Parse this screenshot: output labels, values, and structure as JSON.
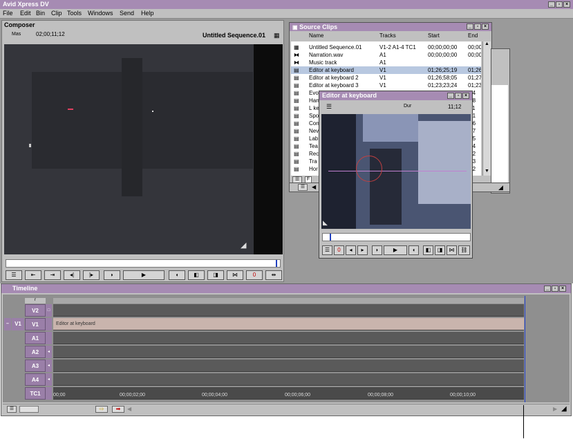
{
  "app": {
    "title": "Avid Xpress DV",
    "menu": [
      "File",
      "Edit",
      "Bin",
      "Clip",
      "Tools",
      "Windows",
      "Send",
      "Help"
    ]
  },
  "composer": {
    "title": "Composer",
    "mas_label": "Mas",
    "timecode": "02;00;11;12",
    "sequence_name": "Untitled Sequence.01"
  },
  "source_clips": {
    "title": "Source Clips",
    "columns": [
      "Name",
      "Tracks",
      "Start",
      "End"
    ],
    "rows": [
      {
        "name": "Untitled Sequence.01",
        "tracks": "V1-2 A1-4 TC1",
        "start": "00;00;00;00",
        "end": "00;00"
      },
      {
        "name": "Narration.wav",
        "tracks": "A1",
        "start": "00;00;00;00",
        "end": "00;00"
      },
      {
        "name": "Music track",
        "tracks": "A1",
        "start": "",
        "end": ""
      },
      {
        "name": "Editor at keyboard",
        "tracks": "V1",
        "start": "01;26;25;19",
        "end": "01;26"
      },
      {
        "name": "Editor at keyboard 2",
        "tracks": "V1",
        "start": "01;26;58;05",
        "end": "01;27"
      },
      {
        "name": "Editor at keyboard 3",
        "tracks": "V1",
        "start": "01;23;23;24",
        "end": "01;23"
      },
      {
        "name": "Evo",
        "tracks": "",
        "start": "",
        "end": ";04"
      },
      {
        "name": "Han",
        "tracks": "",
        "start": "",
        "end": ";08"
      },
      {
        "name": "L ke",
        "tracks": "",
        "start": "",
        "end": ";11"
      },
      {
        "name": "Spo",
        "tracks": "",
        "start": "",
        "end": ";01"
      },
      {
        "name": "Con",
        "tracks": "",
        "start": "",
        "end": ";16"
      },
      {
        "name": "Nev",
        "tracks": "",
        "start": "",
        "end": ";17"
      },
      {
        "name": "Lab",
        "tracks": "",
        "start": "",
        "end": ";25"
      },
      {
        "name": "Tea",
        "tracks": "",
        "start": "",
        "end": ";14"
      },
      {
        "name": "Rec",
        "tracks": "",
        "start": "",
        "end": ";22"
      },
      {
        "name": "Tra",
        "tracks": "",
        "start": "",
        "end": ";03"
      },
      {
        "name": "Hor",
        "tracks": "",
        "start": "",
        "end": ";32"
      }
    ],
    "footer_label": "F"
  },
  "clip_window": {
    "title": "Editor at keyboard",
    "dur_label": "Dur",
    "duration": "11;12"
  },
  "timeline": {
    "title": "Timeline",
    "tracks": [
      {
        "label": "V2",
        "clip": ""
      },
      {
        "label": "V1",
        "clip": "Editor at keyboard"
      },
      {
        "label": "A1",
        "clip": ""
      },
      {
        "label": "A2",
        "clip": ""
      },
      {
        "label": "A3",
        "clip": ""
      },
      {
        "label": "A4",
        "clip": ""
      },
      {
        "label": "TC1",
        "clip": ""
      }
    ],
    "source_track": "V1",
    "ruler": [
      "00;00",
      "00;00;02;00",
      "00;00;04;00",
      "00;00;06;00",
      "00;00;08;00",
      "00;00;10;00"
    ]
  }
}
